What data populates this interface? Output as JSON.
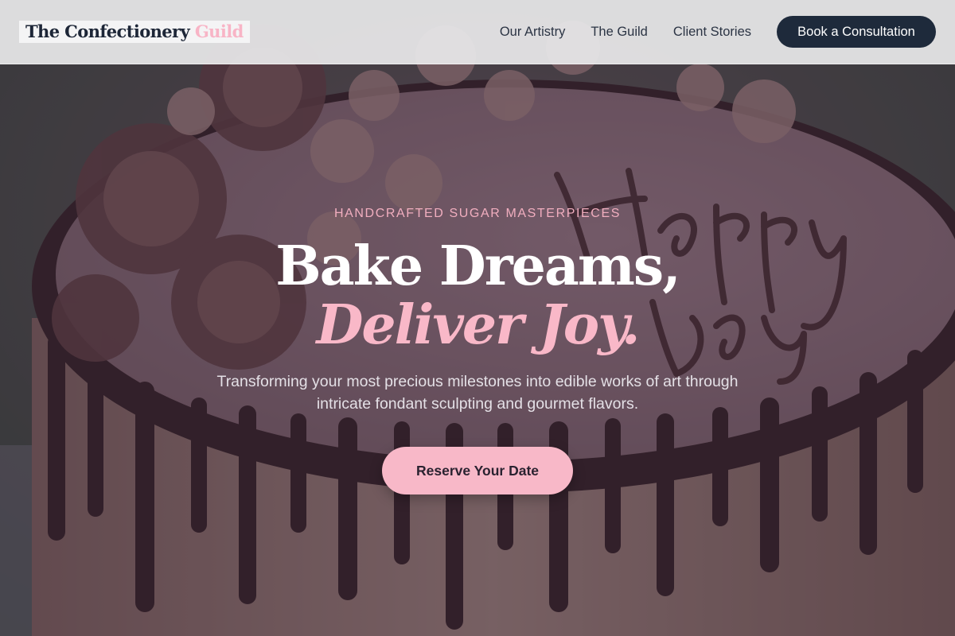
{
  "header": {
    "logo_main": "The Confectionery",
    "logo_accent": "Guild",
    "nav": [
      {
        "label": "Our Artistry"
      },
      {
        "label": "The Guild"
      },
      {
        "label": "Client Stories"
      }
    ],
    "cta_label": "Book a Consultation"
  },
  "hero": {
    "background_image": "chocolate-drip-birthday-cake",
    "eyebrow": "HANDCRAFTED SUGAR MASTERPIECES",
    "headline_line1": "Bake Dreams,",
    "headline_line2": "Deliver Joy.",
    "subtitle": "Transforming your most precious milestones into edible works of art through intricate fondant sculpting and gourmet flavors.",
    "cta_label": "Reserve Your Date"
  },
  "colors": {
    "header_bg": "#e8e8ea",
    "brand_dark": "#1e2a3b",
    "accent_pink": "#f8b8c8",
    "overlay": "#281e30"
  }
}
